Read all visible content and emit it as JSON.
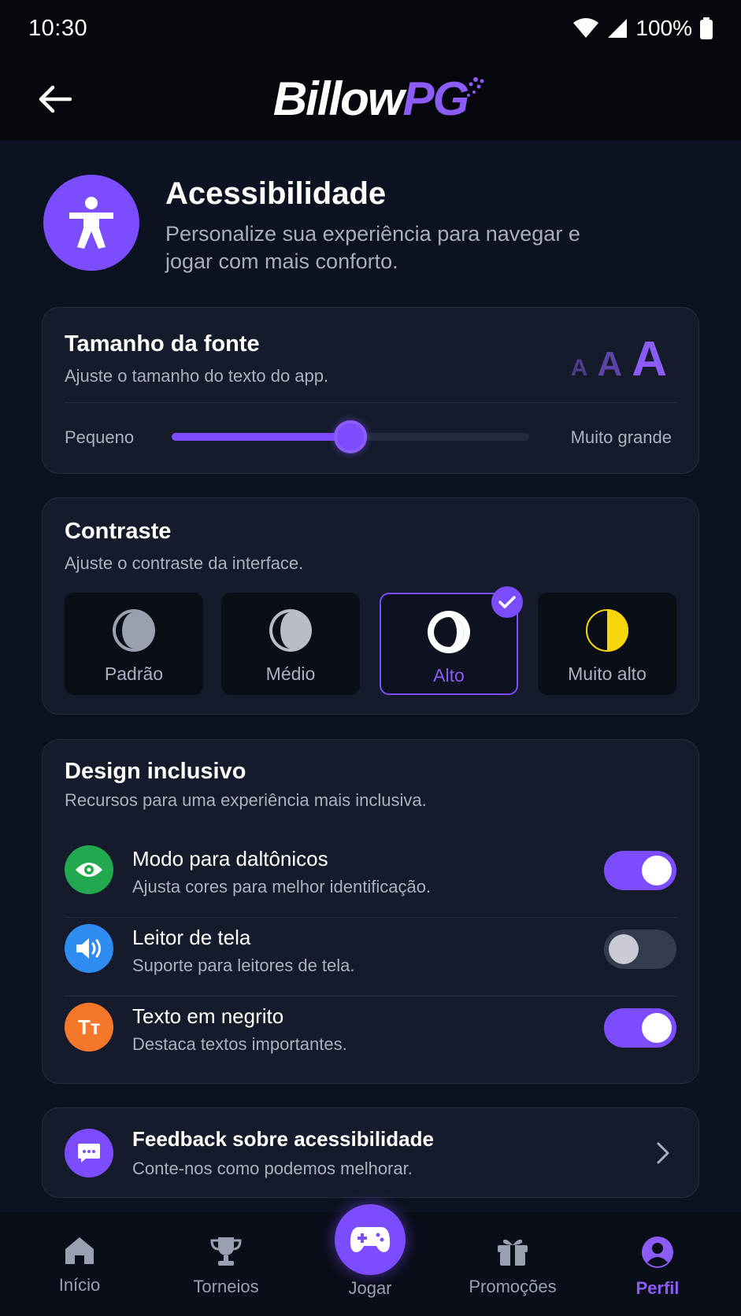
{
  "status": {
    "time": "10:30",
    "battery": "100%"
  },
  "app": {
    "logo_part1": "Billow",
    "logo_part2": "PG"
  },
  "header": {
    "title": "Acessibilidade",
    "subtitle": "Personalize sua experiência para navegar e jogar com mais conforto."
  },
  "font_size": {
    "title": "Tamanho da fonte",
    "subtitle": "Ajuste o tamanho do texto do app.",
    "sample_small": "A",
    "sample_medium": "A",
    "sample_large": "A",
    "min_label": "Pequeno",
    "max_label": "Muito grande",
    "slider_value": 0.5
  },
  "contrast": {
    "title": "Contraste",
    "subtitle": "Ajuste o contraste da interface.",
    "options": [
      {
        "label": "Padrão",
        "selected": false
      },
      {
        "label": "Médio",
        "selected": false
      },
      {
        "label": "Alto",
        "selected": true
      },
      {
        "label": "Muito alto",
        "selected": false
      }
    ]
  },
  "inclusive": {
    "title": "Design inclusivo",
    "subtitle": "Recursos para uma experiência mais inclusiva.",
    "items": [
      {
        "title": "Modo para daltônicos",
        "subtitle": "Ajusta cores para melhor identificação.",
        "enabled": true,
        "icon": "eye-icon",
        "color": "#22a94f"
      },
      {
        "title": "Leitor de tela",
        "subtitle": "Suporte para leitores de tela.",
        "enabled": false,
        "icon": "speaker-icon",
        "color": "#2f8cf0"
      },
      {
        "title": "Texto em negrito",
        "subtitle": "Destaca textos importantes.",
        "enabled": true,
        "icon": "text-size-icon",
        "color": "#f5782a",
        "icon_text": "Tт"
      }
    ]
  },
  "feedback": {
    "title": "Feedback sobre acessibilidade",
    "subtitle": "Conte-nos como podemos melhorar."
  },
  "nav": {
    "items": [
      {
        "label": "Início",
        "icon": "home-icon"
      },
      {
        "label": "Torneios",
        "icon": "trophy-icon"
      },
      {
        "label": "Jogar",
        "icon": "gamepad-icon"
      },
      {
        "label": "Promoções",
        "icon": "gift-icon"
      },
      {
        "label": "Perfil",
        "icon": "profile-icon",
        "active": true
      }
    ]
  },
  "colors": {
    "accent": "#7c4dff",
    "background": "#0d1220",
    "card": "#151b2a"
  }
}
